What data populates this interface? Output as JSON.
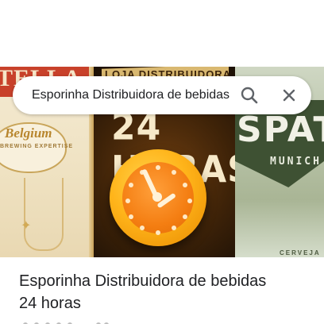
{
  "search": {
    "query": "Esporinha Distribuidora de bebidas"
  },
  "hero": {
    "left_panel": {
      "band_text": "TELLA",
      "brand": "Belgium",
      "tagline": "BREWING EXPERTISE"
    },
    "middle_panel": {
      "banner_text": "LOJA DISTRIBUIDORA",
      "big_text": "24 HORAS"
    },
    "right_panel": {
      "brand": "SPAT",
      "city": "MUNICH",
      "footer": "CERVEJA"
    }
  },
  "place": {
    "title_line1": "Esporinha Distribuidora de bebidas",
    "title_line2": "24 horas"
  },
  "colors": {
    "accent_orange": "#f47e12",
    "text_primary": "#202124",
    "icon_gray": "#5f6368"
  }
}
